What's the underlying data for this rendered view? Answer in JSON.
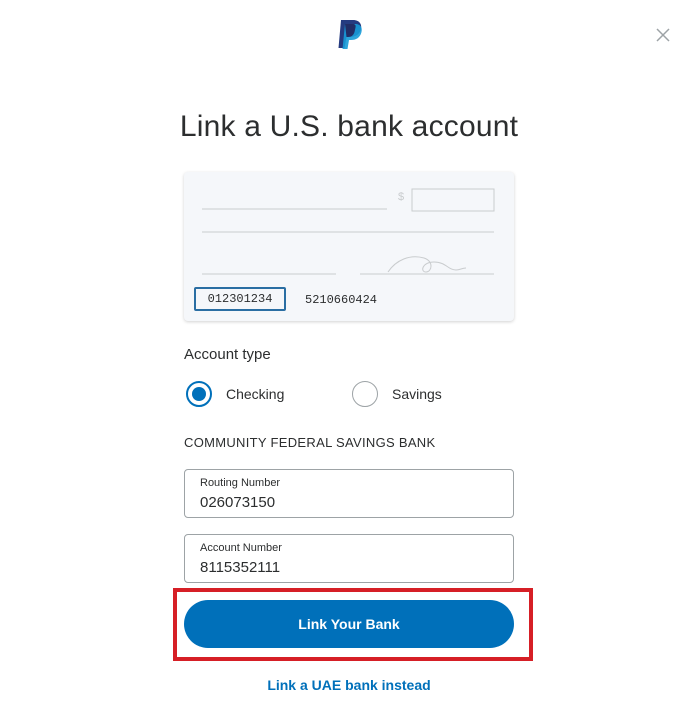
{
  "header": {
    "logo_icon": "paypal-logo",
    "close_icon": "close-icon"
  },
  "title": "Link a U.S. bank account",
  "check_illustration": {
    "routing_number": "012301234",
    "account_number": "5210660424",
    "currency_symbol": "$"
  },
  "account_type": {
    "label": "Account type",
    "options": [
      {
        "label": "Checking",
        "selected": true
      },
      {
        "label": "Savings",
        "selected": false
      }
    ]
  },
  "bank_name": "COMMUNITY FEDERAL SAVINGS BANK",
  "fields": {
    "routing": {
      "label": "Routing Number",
      "value": "026073150"
    },
    "account": {
      "label": "Account Number",
      "value": "8115352111"
    }
  },
  "submit_label": "Link Your Bank",
  "alt_link": "Link a UAE bank instead",
  "colors": {
    "primary": "#0070ba",
    "highlight": "#d61f26",
    "text": "#2c2e2f"
  }
}
